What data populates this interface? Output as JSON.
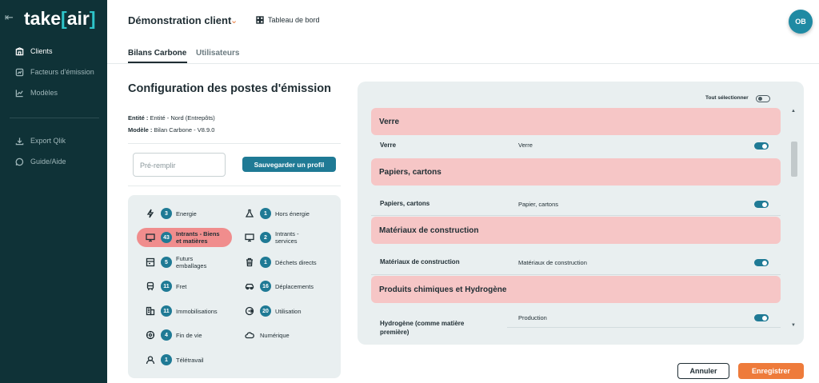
{
  "app": {
    "logo_main": "take",
    "logo_bracket_open": "[",
    "logo_accent": "air",
    "logo_bracket_close": "]"
  },
  "sidebar": {
    "items": [
      {
        "label": "Clients",
        "icon": "building-icon",
        "active": true
      },
      {
        "label": "Facteurs d'émission",
        "icon": "factor-icon",
        "active": false
      },
      {
        "label": "Modèles",
        "icon": "chart-line-icon",
        "active": false
      },
      {
        "label": "Export Qlik",
        "icon": "download-icon",
        "active": false
      },
      {
        "label": "Guide/Aide",
        "icon": "help-chat-icon",
        "active": false
      }
    ]
  },
  "header": {
    "client": "Démonstration client",
    "dashboard": "Tableau de bord",
    "avatar": "OB"
  },
  "tabs": [
    "Bilans Carbone",
    "Utilisateurs"
  ],
  "left": {
    "title": "Configuration des postes d'émission",
    "entity_label": "Entité :",
    "entity_value": "Entité - Nord (Entrepôts)",
    "model_label": "Modèle :",
    "model_value": "Bilan Carbone - V8.9.0",
    "prefill_placeholder": "Pré-remplir",
    "save_profile": "Sauvegarder un profil"
  },
  "categories": [
    {
      "count": "3",
      "label": "Energie",
      "icon": "lightning-icon",
      "selected": false
    },
    {
      "count": "1",
      "label": "Hors énergie",
      "icon": "flask-icon",
      "selected": false
    },
    {
      "count": "43",
      "label": "Intrants - Biens et matières",
      "icon": "monitor-icon",
      "selected": true
    },
    {
      "count": "2",
      "label": "Intrants - services",
      "icon": "monitor-icon",
      "selected": false
    },
    {
      "count": "5",
      "label": "Futurs emballages",
      "icon": "package-icon",
      "selected": false
    },
    {
      "count": "1",
      "label": "Déchets directs",
      "icon": "trash-icon",
      "selected": false
    },
    {
      "count": "11",
      "label": "Fret",
      "icon": "train-icon",
      "selected": false
    },
    {
      "count": "16",
      "label": "Déplacements",
      "icon": "car-icon",
      "selected": false
    },
    {
      "count": "11",
      "label": "Immobilisations",
      "icon": "buildings-icon",
      "selected": false
    },
    {
      "count": "20",
      "label": "Utilisation",
      "icon": "plug-icon",
      "selected": false
    },
    {
      "count": "4",
      "label": "Fin de vie",
      "icon": "recycle-icon",
      "selected": false
    },
    {
      "count": "",
      "label": "Numérique",
      "icon": "cloud-icon",
      "selected": false
    },
    {
      "count": "1",
      "label": "Télétravail",
      "icon": "home-worker-icon",
      "selected": false
    }
  ],
  "right": {
    "select_all": "Tout sélectionner",
    "groups": [
      {
        "title": "Verre",
        "rows": [
          {
            "name": "Verre",
            "desc": "Verre",
            "on": true
          }
        ]
      },
      {
        "title": "Papiers, cartons",
        "rows": [
          {
            "name": "Papiers, cartons",
            "desc": "Papier, cartons",
            "on": true
          }
        ]
      },
      {
        "title": "Matériaux de construction",
        "rows": [
          {
            "name": "Matériaux de construction",
            "desc": "Matériaux de construction",
            "on": true
          }
        ]
      },
      {
        "title": "Produits chimiques et Hydrogène",
        "rows": [
          {
            "name": "Hydrogène (comme matière première)",
            "desc": "Production",
            "on": true
          }
        ]
      }
    ]
  },
  "footer": {
    "cancel": "Annuler",
    "save": "Enregistrer"
  },
  "colors": {
    "sidebar_bg": "#0f3237",
    "accent_teal": "#1f7a95",
    "accent_orange": "#ee7b3b",
    "group_pink": "#f6c6c6",
    "selected_category": "#f08d8d"
  }
}
